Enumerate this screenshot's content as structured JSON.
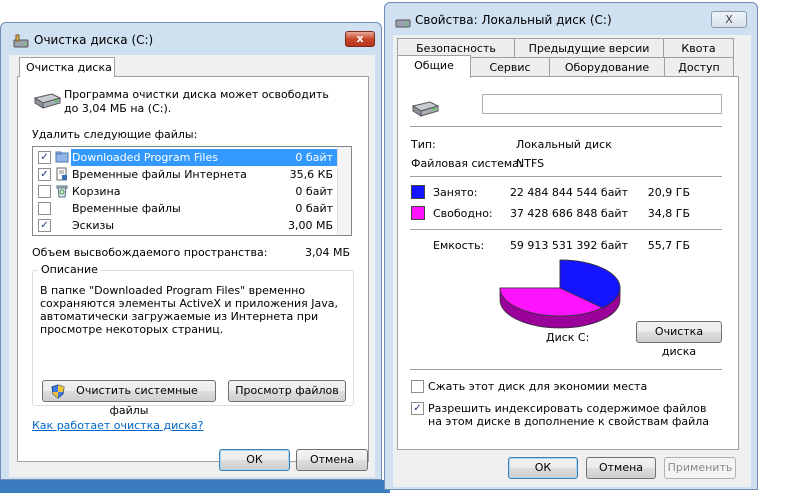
{
  "cleanup": {
    "title": "Очистка диска  (C:)",
    "close": "x",
    "tab": "Очистка диска",
    "intro": "Программа очистки диска может освободить до 3,04 МБ на  (C:).",
    "files_label": "Удалить следующие файлы:",
    "files": [
      {
        "name": "Downloaded Program Files",
        "size": "0 байт",
        "checked": true,
        "selected": true,
        "icon": "folder-icon"
      },
      {
        "name": "Временные файлы Интернета",
        "size": "35,6 КБ",
        "checked": true,
        "selected": false,
        "icon": "document-lock-icon"
      },
      {
        "name": "Корзина",
        "size": "0 байт",
        "checked": false,
        "selected": false,
        "icon": "recycle-bin-icon"
      },
      {
        "name": "Временные файлы",
        "size": "0 байт",
        "checked": false,
        "selected": false,
        "icon": "blank-icon"
      },
      {
        "name": "Эскизы",
        "size": "3,00 МБ",
        "checked": true,
        "selected": false,
        "icon": "blank-icon"
      }
    ],
    "space_label": "Объем высвобождаемого пространства:",
    "space_value": "3,04 МБ",
    "desc_title": "Описание",
    "description": "В папке \"Downloaded Program Files\" временно сохраняются элементы ActiveX и приложения Java, автоматически загружаемые из Интернета при просмотре некоторых страниц.",
    "system_files_button": "Очистить системные файлы",
    "view_files_button": "Просмотр файлов",
    "help_link": "Как работает очистка диска?",
    "ok": "ОК",
    "cancel": "Отмена"
  },
  "properties": {
    "title": "Свойства: Локальный диск (C:)",
    "close": "X",
    "tabs_row1": [
      "Безопасность",
      "Предыдущие версии",
      "Квота"
    ],
    "tabs_row2": [
      "Общие",
      "Сервис",
      "Оборудование",
      "Доступ"
    ],
    "active_tab": "Общие",
    "drive_name": "",
    "type_label": "Тип:",
    "type_value": "Локальный диск",
    "fs_label": "Файловая система:",
    "fs_value": "NTFS",
    "used_label": "Занято:",
    "used_bytes": "22 484 844 544 байт",
    "used_gb": "20,9 ГБ",
    "free_label": "Свободно:",
    "free_bytes": "37 428 686 848 байт",
    "free_gb": "34,8 ГБ",
    "capacity_label": "Емкость:",
    "capacity_bytes": "59 913 531 392 байт",
    "capacity_gb": "55,7 ГБ",
    "disk_label": "Диск C:",
    "cleanup_button": "Очистка диска",
    "compress_label": "Сжать этот диск для экономии места",
    "compress_checked": false,
    "index_label": "Разрешить индексировать содержимое файлов на этом диске в дополнение к свойствам файла",
    "index_checked": true,
    "ok": "ОК",
    "cancel": "Отмена",
    "apply": "Применить",
    "used_color": "#1414ff",
    "free_color": "#ff14ff",
    "used_fraction": 0.375
  }
}
